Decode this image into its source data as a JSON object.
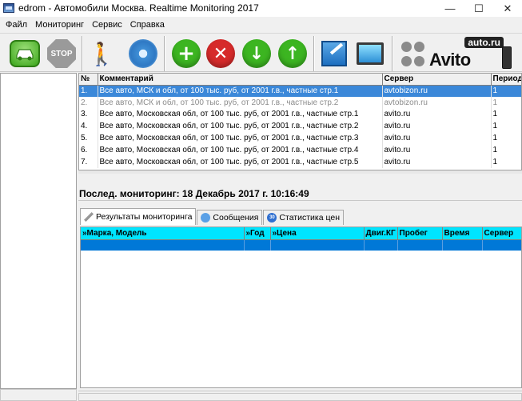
{
  "window": {
    "title": "edrom - Автомобили Москва. Realtime Monitoring 2017",
    "minimize": "—",
    "maximize": "☐",
    "close": "✕"
  },
  "menu": [
    "Файл",
    "Мониторинг",
    "Сервис",
    "Справка"
  ],
  "toolbar": {
    "stop_label": "STOP",
    "avito_auto": "auto.ru",
    "avito_name": "Avito"
  },
  "grid": {
    "columns": [
      "№",
      "Комментарий",
      "Сервер",
      "Период"
    ],
    "rows": [
      {
        "num": "1.",
        "comment": "Все авто, МСК и обл, от 100 тыс. руб, от 2001 г.в., частные стр.1",
        "server": "avtobizon.ru",
        "period": "1"
      },
      {
        "num": "2.",
        "comment": "Все авто, МСК и обл, от 100 тыс. руб, от 2001 г.в., частные стр.2",
        "server": "avtobizon.ru",
        "period": "1"
      },
      {
        "num": "3.",
        "comment": "Все авто, Московская обл, от 100 тыс. руб, от 2001 г.в., частные стр.1",
        "server": "avito.ru",
        "period": "1"
      },
      {
        "num": "4.",
        "comment": "Все авто, Московская обл, от 100 тыс. руб, от 2001 г.в., частные стр.2",
        "server": "avito.ru",
        "period": "1"
      },
      {
        "num": "5.",
        "comment": "Все авто, Московская обл, от 100 тыс. руб, от 2001 г.в., частные стр.3",
        "server": "avito.ru",
        "period": "1"
      },
      {
        "num": "6.",
        "comment": "Все авто, Московская обл, от 100 тыс. руб, от 2001 г.в., частные стр.4",
        "server": "avito.ru",
        "period": "1"
      },
      {
        "num": "7.",
        "comment": "Все авто, Московская обл, от 100 тыс. руб, от 2001 г.в., частные стр.5",
        "server": "avito.ru",
        "period": "1"
      }
    ]
  },
  "last_monitoring": "Послед. мониторинг: 18 Декабрь 2017 г. 10:16:49",
  "tabs": [
    "Результаты мониторинга",
    "Сообщения",
    "Статистика цен"
  ],
  "tab_icon_30": "30",
  "results": {
    "columns": [
      "»Марка, Модель",
      "»Год",
      "»Цена",
      "Двиг.КГ",
      "Пробег",
      "Время",
      "Сервер"
    ]
  }
}
